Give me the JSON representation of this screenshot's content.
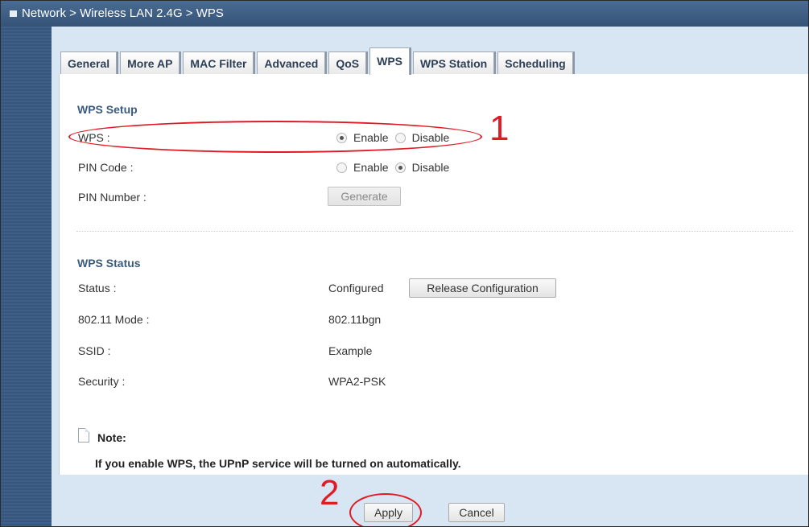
{
  "breadcrumb": "Network > Wireless LAN 2.4G > WPS",
  "tabs": [
    {
      "label": "General"
    },
    {
      "label": "More AP"
    },
    {
      "label": "MAC Filter"
    },
    {
      "label": "Advanced"
    },
    {
      "label": "QoS"
    },
    {
      "label": "WPS",
      "active": true
    },
    {
      "label": "WPS Station"
    },
    {
      "label": "Scheduling"
    }
  ],
  "wps_setup": {
    "title": "WPS Setup",
    "wps_label": "WPS :",
    "wps_enable": "Enable",
    "wps_disable": "Disable",
    "wps_selected": "Enable",
    "pin_code_label": "PIN Code :",
    "pin_enable": "Enable",
    "pin_disable": "Disable",
    "pin_selected": "Disable",
    "pin_number_label": "PIN Number :",
    "generate_button": "Generate"
  },
  "wps_status": {
    "title": "WPS Status",
    "status_label": "Status :",
    "status_value": "Configured",
    "release_button": "Release Configuration",
    "mode_label": "802.11 Mode :",
    "mode_value": "802.11bgn",
    "ssid_label": "SSID :",
    "ssid_value": "Example",
    "security_label": "Security :",
    "security_value": "WPA2-PSK"
  },
  "note": {
    "title": "Note:",
    "text": "If you enable WPS, the UPnP service will be turned on automatically."
  },
  "footer": {
    "apply": "Apply",
    "cancel": "Cancel"
  },
  "callouts": {
    "one": "1",
    "two": "2"
  },
  "colors": {
    "titlebar": "#355377",
    "background": "#d8e5f3",
    "section_title": "#3a5b7e",
    "callout": "#e01b24"
  }
}
